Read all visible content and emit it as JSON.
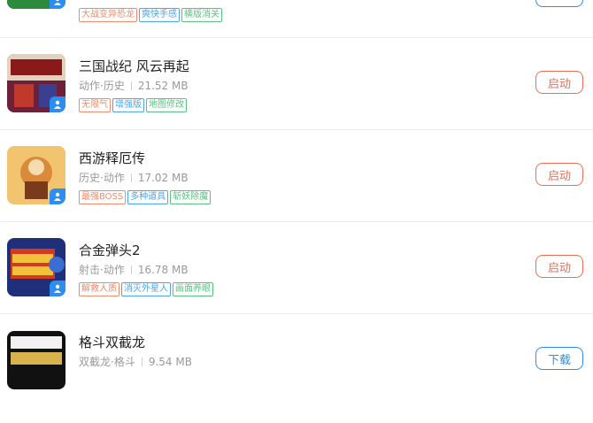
{
  "games": [
    {
      "title": "",
      "category": "",
      "size": "",
      "tags": [
        {
          "label": "大战变异恐龙",
          "color": "#f28b6b"
        },
        {
          "label": "爽快手感",
          "color": "#4aa6f0"
        },
        {
          "label": "横版消关",
          "color": "#59c481"
        }
      ],
      "button": {
        "label": "",
        "kind": "download"
      }
    },
    {
      "title": "三国战纪 风云再起",
      "category": "动作·历史",
      "size": "21.52 MB",
      "tags": [
        {
          "label": "无限气",
          "color": "#f28b6b"
        },
        {
          "label": "增强版",
          "color": "#4aa6f0"
        },
        {
          "label": "地图修改",
          "color": "#59c481"
        }
      ],
      "button": {
        "label": "启动",
        "kind": "launch"
      }
    },
    {
      "title": "西游释厄传",
      "category": "历史·动作",
      "size": "17.02 MB",
      "tags": [
        {
          "label": "最强BOSS",
          "color": "#f28b6b"
        },
        {
          "label": "多种道具",
          "color": "#4aa6f0"
        },
        {
          "label": "斩妖除魔",
          "color": "#59c481"
        }
      ],
      "button": {
        "label": "启动",
        "kind": "launch"
      }
    },
    {
      "title": "合金弹头2",
      "category": "射击·动作",
      "size": "16.78 MB",
      "tags": [
        {
          "label": "解救人质",
          "color": "#f28b6b"
        },
        {
          "label": "消灭外星人",
          "color": "#4aa6f0"
        },
        {
          "label": "画面养眼",
          "color": "#59c481"
        }
      ],
      "button": {
        "label": "启动",
        "kind": "launch"
      }
    },
    {
      "title": "格斗双截龙",
      "category": "双截龙·格斗",
      "size": "9.54 MB",
      "tags": [],
      "button": {
        "label": "下载",
        "kind": "download"
      }
    }
  ],
  "colors": {
    "launch": "#f06b53",
    "download": "#2c8ef2",
    "badge": "#2c8ef2"
  }
}
